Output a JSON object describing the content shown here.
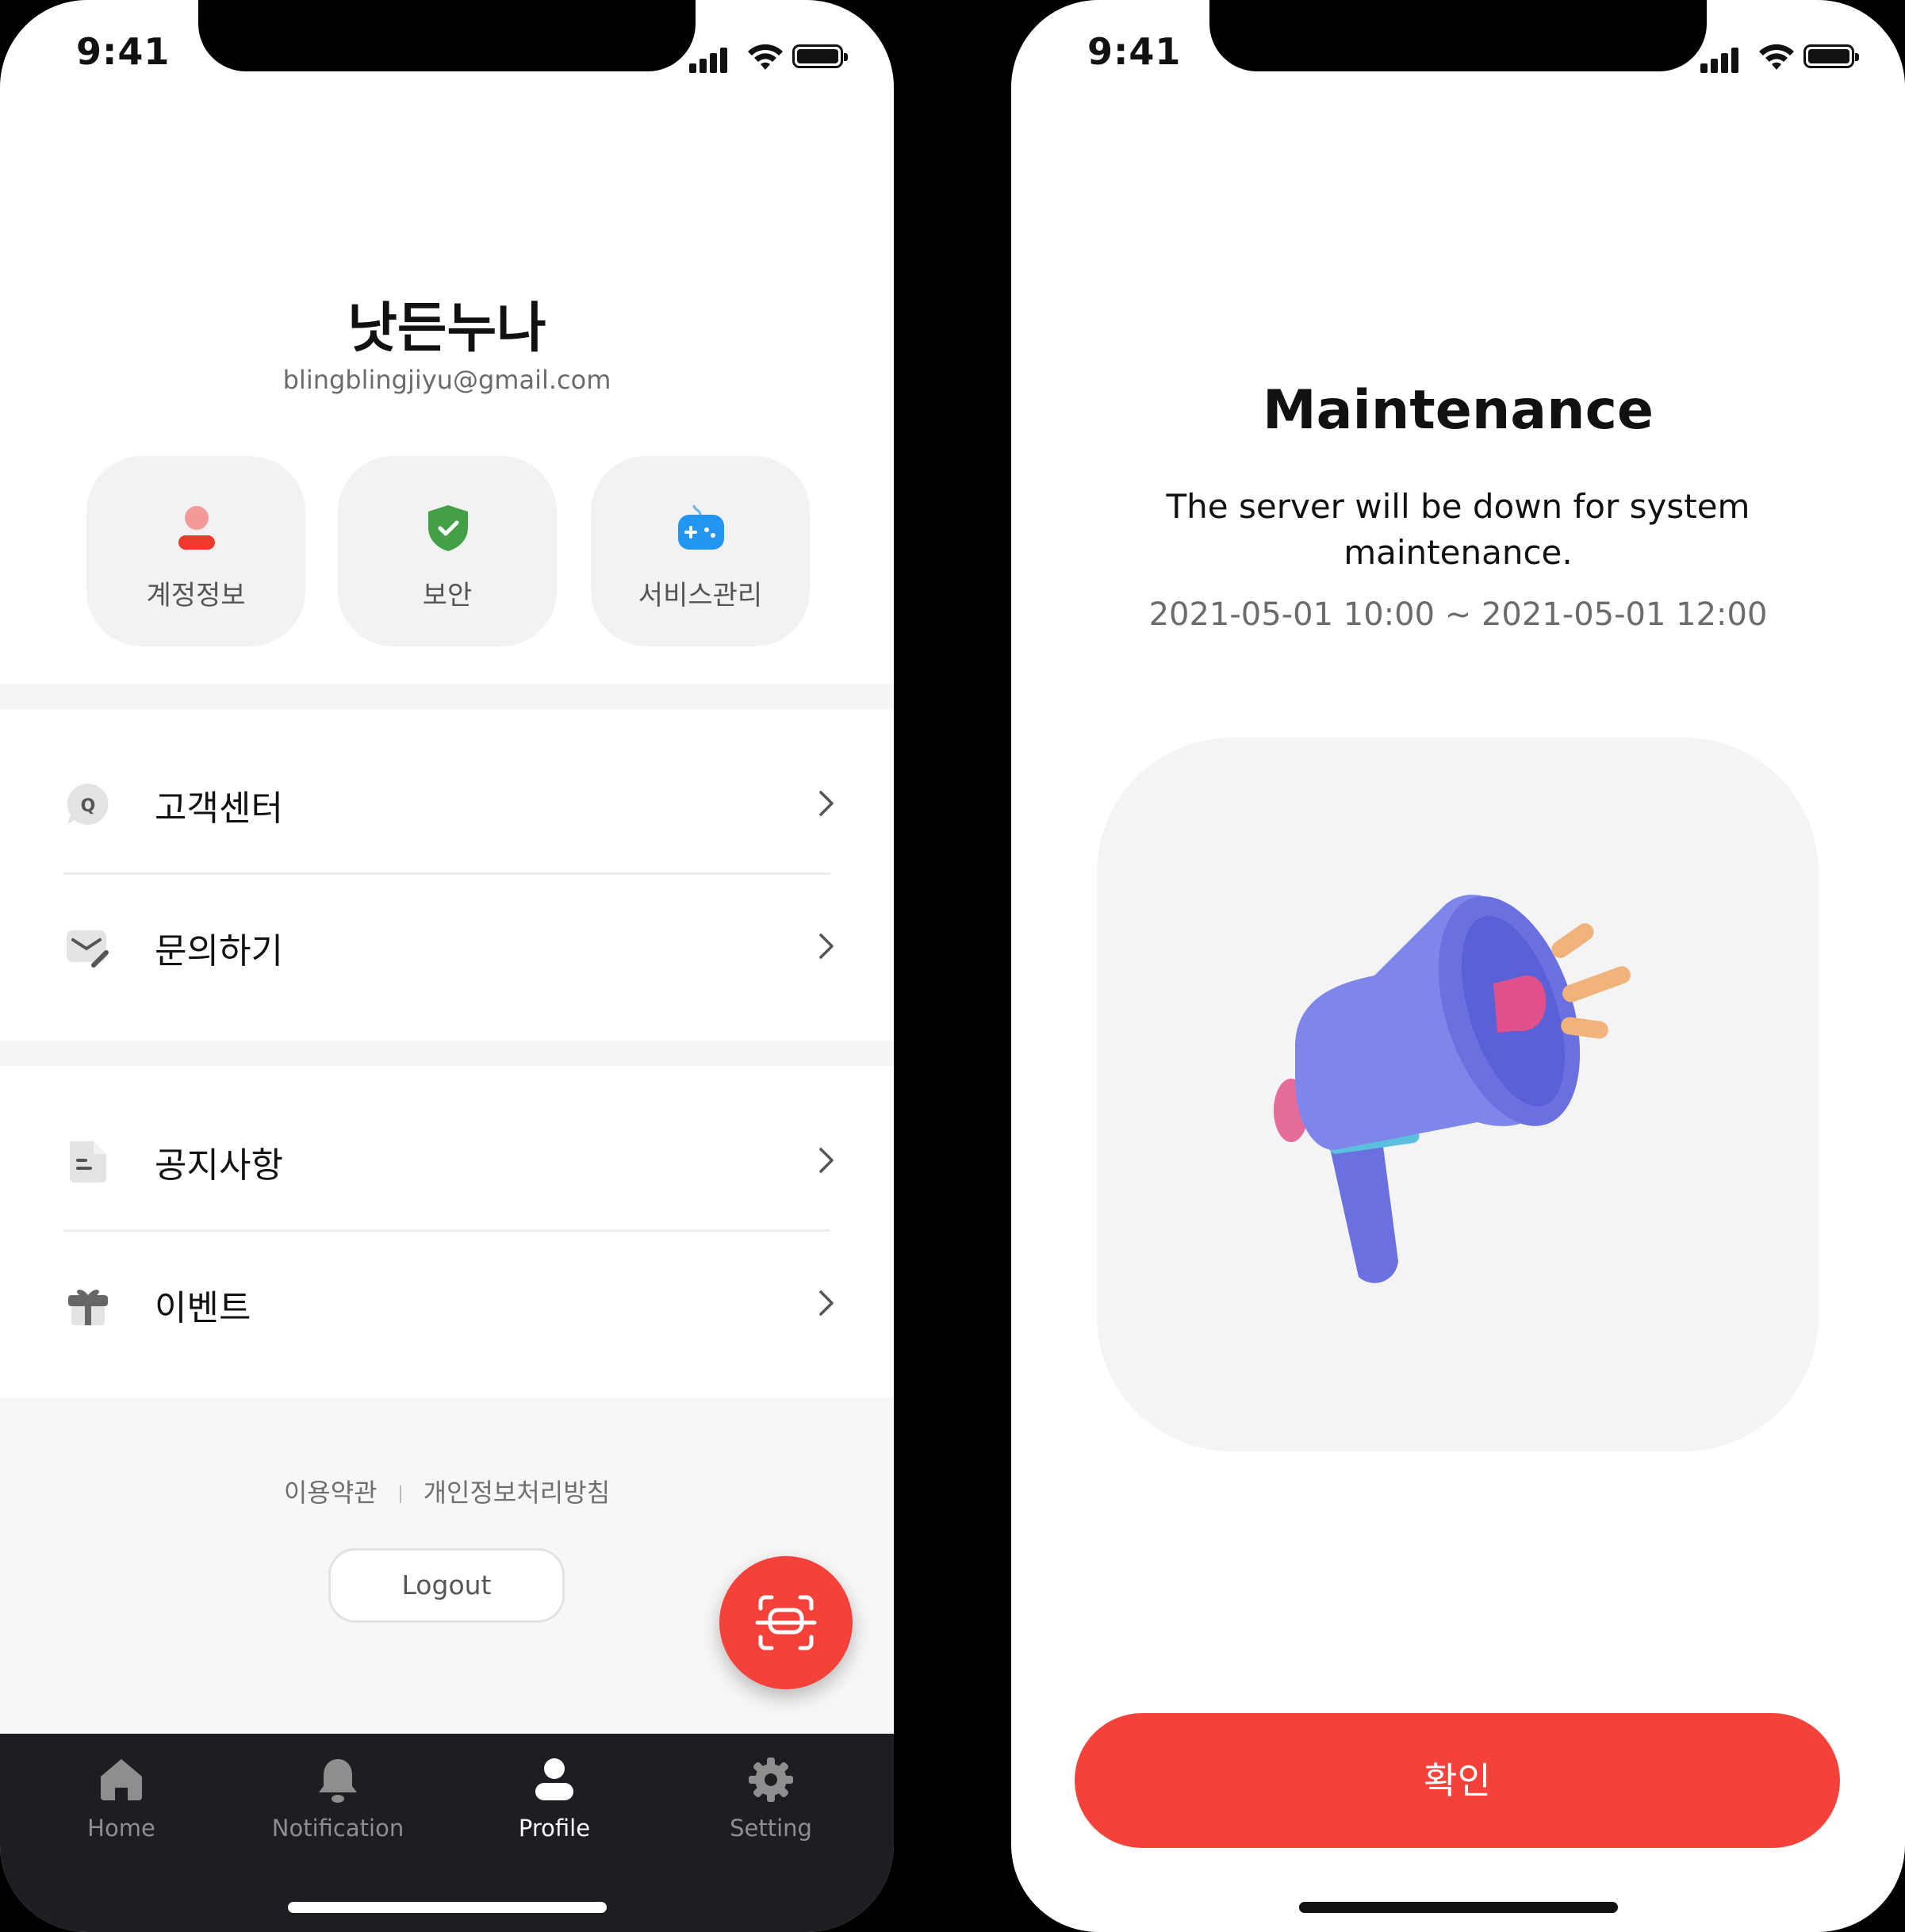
{
  "status_bar": {
    "time": "9:41"
  },
  "left": {
    "profile": {
      "name": "낫든누나",
      "email": "blingblingjiyu@gmail.com"
    },
    "quick_actions": [
      {
        "label": "계정정보",
        "icon": "user-icon",
        "color": "#f03a2e"
      },
      {
        "label": "보안",
        "icon": "shield-check-icon",
        "color": "#43a047"
      },
      {
        "label": "서비스관리",
        "icon": "gamepad-icon",
        "color": "#2196f3"
      }
    ],
    "menu_group_1": [
      {
        "label": "고객센터",
        "icon": "chat-q-icon"
      },
      {
        "label": "문의하기",
        "icon": "mail-edit-icon"
      }
    ],
    "menu_group_2": [
      {
        "label": "공지사항",
        "icon": "document-icon"
      },
      {
        "label": "이벤트",
        "icon": "gift-icon"
      }
    ],
    "footer": {
      "terms": "이용약관",
      "privacy": "개인정보처리방침",
      "logout": "Logout"
    },
    "fab": {
      "icon": "scan-icon",
      "color": "#f4423a"
    },
    "tabs": [
      {
        "label": "Home",
        "icon": "home-icon",
        "active": false
      },
      {
        "label": "Notification",
        "icon": "bell-icon",
        "active": false
      },
      {
        "label": "Profile",
        "icon": "profile-icon",
        "active": true
      },
      {
        "label": "Setting",
        "icon": "gear-icon",
        "active": false
      }
    ]
  },
  "right": {
    "title": "Maintenance",
    "description": "The server will be down for system maintenance.",
    "schedule": "2021-05-01 10:00 ~ 2021-05-01 12:00",
    "illustration": "megaphone-icon",
    "confirm": "확인"
  },
  "colors": {
    "accent": "#f4423a",
    "tabbar": "#1d1e22"
  }
}
